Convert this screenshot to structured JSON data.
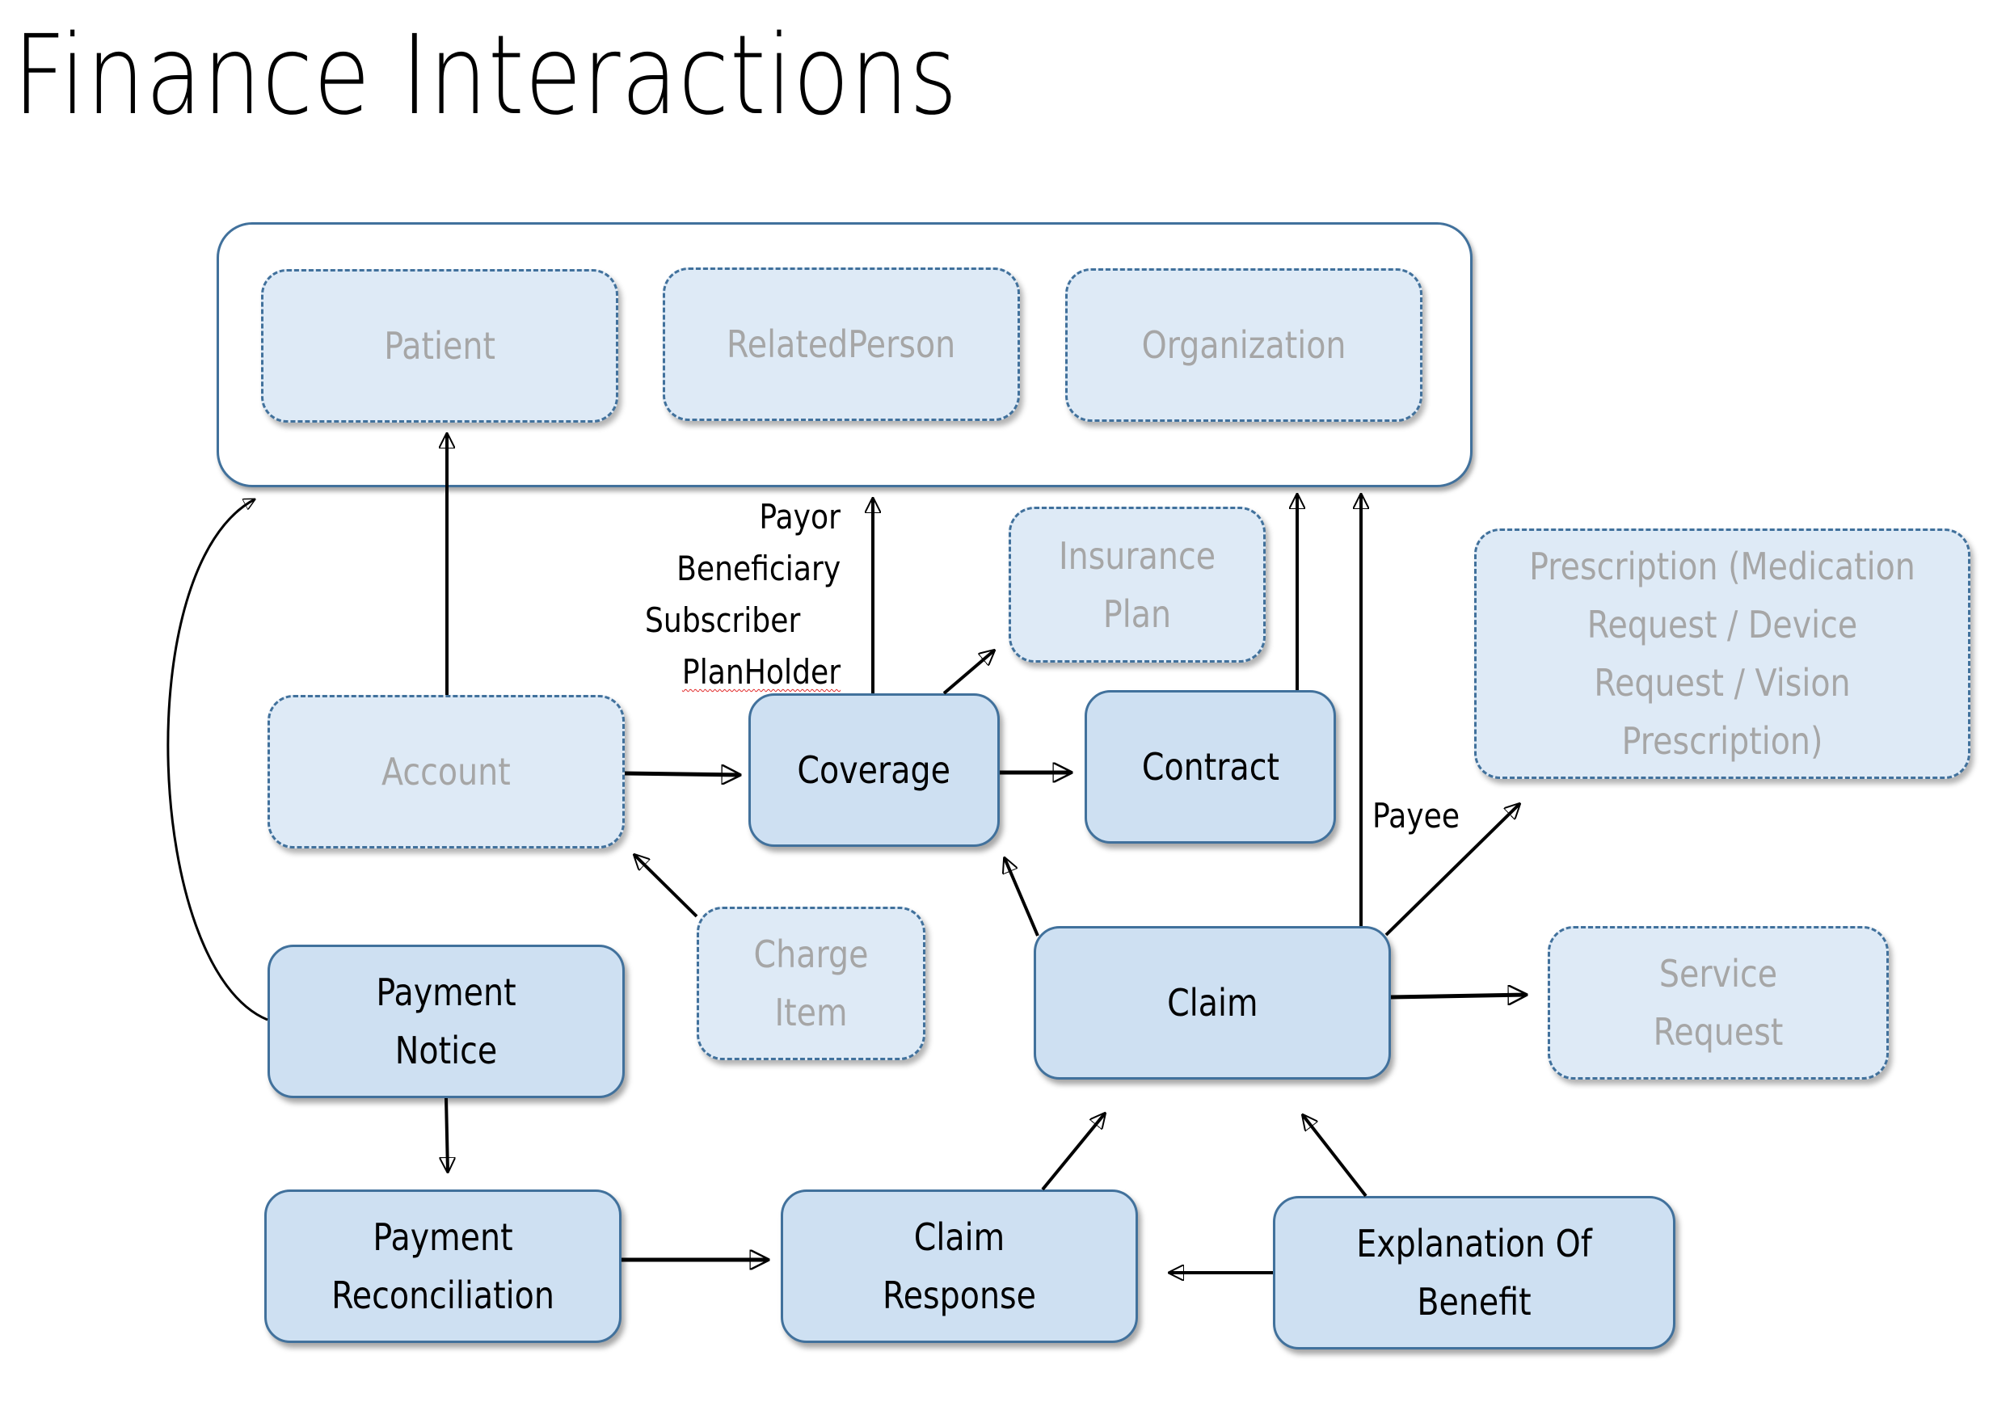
{
  "title": "Finance Interactions",
  "colors": {
    "solid_fill": "#CEE0F2",
    "dashed_fill": "#DEEAF6",
    "border": "#41719C",
    "dashed_text": "#A6A6A6",
    "solid_text": "#000000"
  },
  "nodes": {
    "patient": {
      "label": "Patient",
      "style": "dashed"
    },
    "related_person": {
      "label": "RelatedPerson",
      "style": "dashed"
    },
    "organization": {
      "label": "Organization",
      "style": "dashed"
    },
    "insurance_plan": {
      "label": "Insurance Plan",
      "style": "dashed"
    },
    "prescription": {
      "label": "Prescription (Medication Request / Device Request / Vision Prescription)",
      "style": "dashed"
    },
    "account": {
      "label": "Account",
      "style": "dashed"
    },
    "coverage": {
      "label": "Coverage",
      "style": "solid"
    },
    "contract": {
      "label": "Contract",
      "style": "solid"
    },
    "charge_item": {
      "label": "Charge Item",
      "style": "dashed"
    },
    "claim": {
      "label": "Claim",
      "style": "solid"
    },
    "service_request": {
      "label": "Service Request",
      "style": "dashed"
    },
    "payment_notice": {
      "label": "Payment Notice",
      "style": "solid"
    },
    "payment_reconciliation": {
      "label": "Payment Reconciliation",
      "style": "solid"
    },
    "claim_response": {
      "label": "Claim Response",
      "style": "solid"
    },
    "explanation_of_benefit": {
      "label": "Explanation Of Benefit",
      "style": "solid"
    }
  },
  "edge_labels": {
    "coverage_roles": [
      "Payor",
      "Beneficiary",
      "Subscriber",
      "PlanHolder"
    ],
    "payee": "Payee"
  },
  "edges": [
    {
      "from": "account",
      "to": "patient"
    },
    {
      "from": "account",
      "to": "coverage"
    },
    {
      "from": "coverage",
      "to": "party-group",
      "label": "Payor / Beneficiary / Subscriber / PlanHolder"
    },
    {
      "from": "coverage",
      "to": "insurance_plan"
    },
    {
      "from": "coverage",
      "to": "contract"
    },
    {
      "from": "contract",
      "to": "party-group"
    },
    {
      "from": "claim",
      "to": "party-group",
      "label": "Payee"
    },
    {
      "from": "claim",
      "to": "prescription"
    },
    {
      "from": "claim",
      "to": "service_request"
    },
    {
      "from": "claim",
      "to": "coverage"
    },
    {
      "from": "charge_item",
      "to": "account"
    },
    {
      "from": "payment_notice",
      "to": "party-group"
    },
    {
      "from": "payment_notice",
      "to": "payment_reconciliation"
    },
    {
      "from": "payment_reconciliation",
      "to": "claim_response"
    },
    {
      "from": "claim_response",
      "to": "claim"
    },
    {
      "from": "explanation_of_benefit",
      "to": "claim_response"
    },
    {
      "from": "explanation_of_benefit",
      "to": "claim"
    }
  ]
}
